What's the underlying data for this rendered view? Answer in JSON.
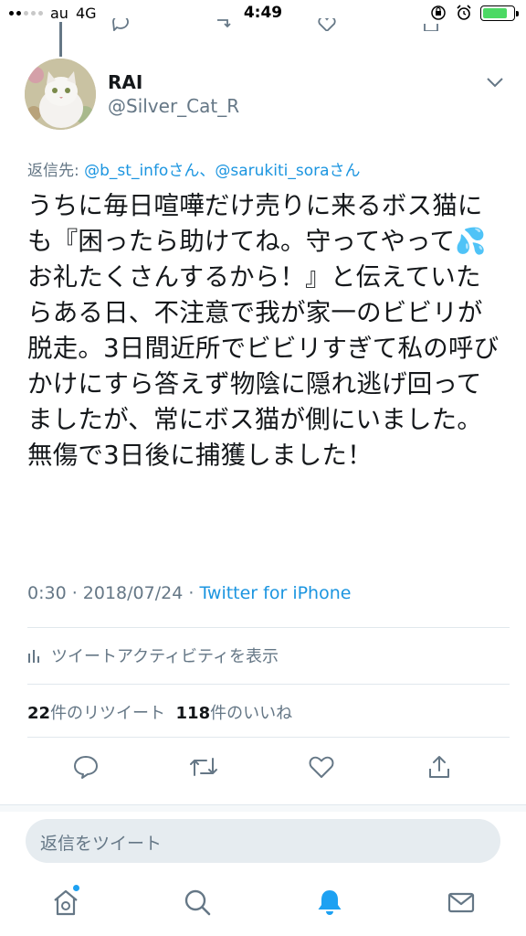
{
  "status_bar": {
    "carrier": "au",
    "network": "4G",
    "time": "4:49"
  },
  "tweet": {
    "author_name": "RAI",
    "author_handle": "@Silver_Cat_R",
    "reply_to_prefix": "返信先: ",
    "reply_to_user1": "@b_st_infoさん",
    "reply_to_separator": "、",
    "reply_to_user2": "@sarukiti_soraさん",
    "text_part1": "うちに毎日喧嘩だけ売りに来るボス猫にも『困ったら助けてね。守ってやって",
    "emoji": "💦",
    "text_part2": "お礼たくさんするから！』と伝えていたらある日、不注意で我が家一のビビリが脱走。3日間近所でビビリすぎて私の呼びかけにすら答えず物陰に隠れ逃げ回ってましたが、常にボス猫が側にいました。無傷で3日後に捕獲しました！",
    "time": "0:30",
    "meta_separator": " · ",
    "date": "2018/07/24",
    "source": "Twitter for iPhone"
  },
  "activity": {
    "label": "ツイートアクティビティを表示"
  },
  "counts": {
    "retweets": "22",
    "retweets_label": "件のリツイート",
    "likes": "118",
    "likes_label": "件のいいね"
  },
  "reply_box": {
    "placeholder": "返信をツイート"
  },
  "colors": {
    "accent": "#1da1f2",
    "link": "#1b95e0",
    "secondary_text": "#657786",
    "divider": "#e1e8ed"
  },
  "icons": [
    "reply-icon",
    "retweet-icon",
    "like-icon",
    "share-icon",
    "home-icon",
    "search-icon",
    "bell-icon",
    "mail-icon"
  ]
}
